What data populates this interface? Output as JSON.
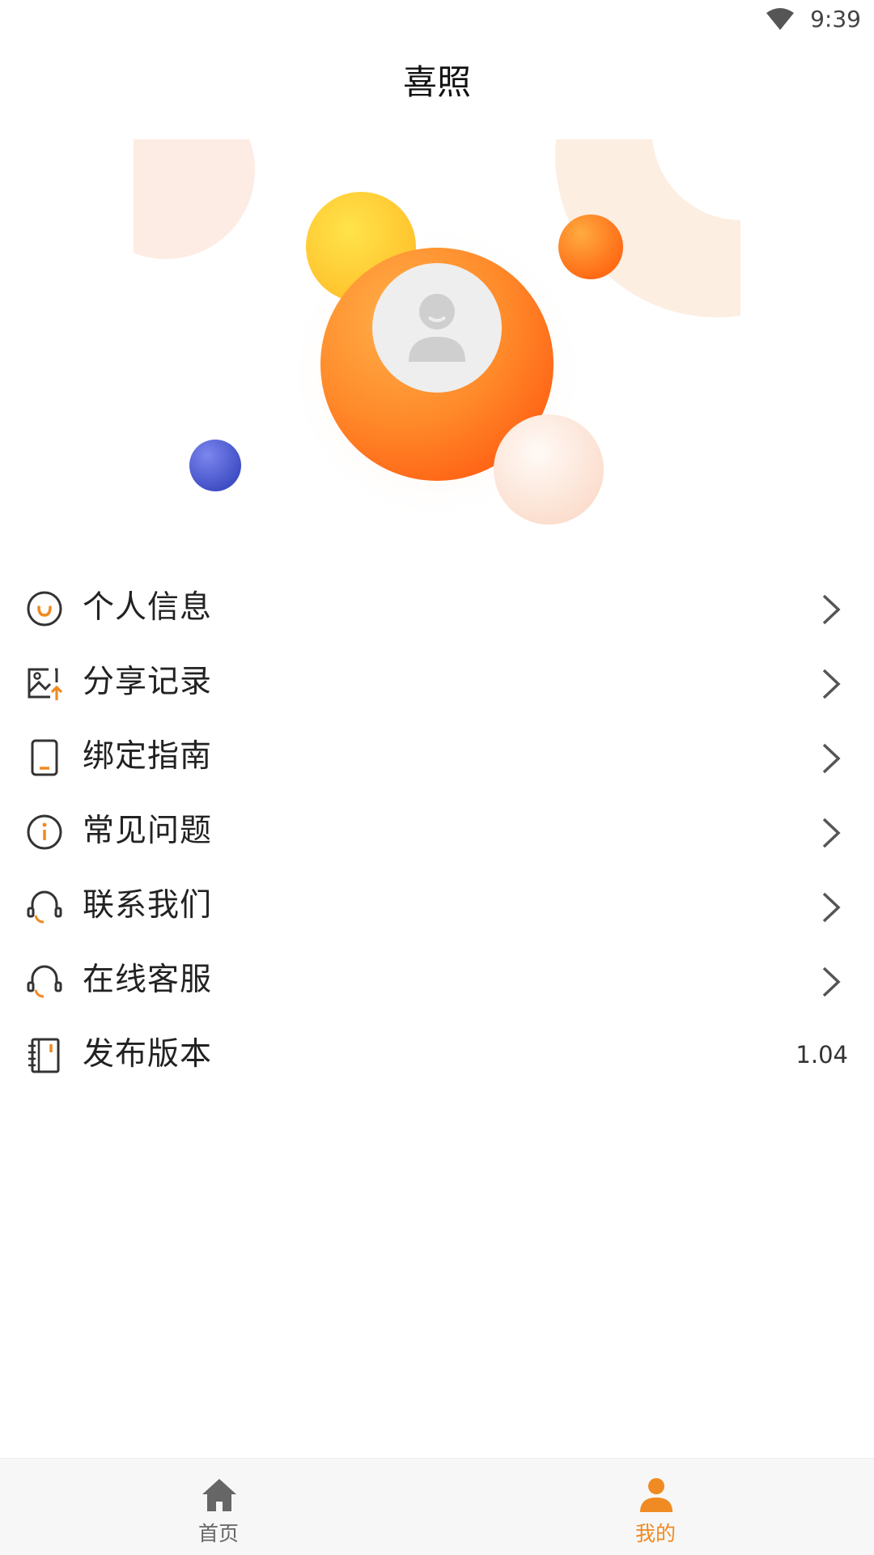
{
  "status_bar": {
    "time": "9:39",
    "wifi_icon": "wifi-icon"
  },
  "header": {
    "title": "喜照"
  },
  "profile": {
    "avatar_icon": "default-avatar-icon"
  },
  "menu": {
    "items": [
      {
        "label": "个人信息",
        "icon": "smile-icon",
        "trailing": "chevron-right-icon"
      },
      {
        "label": "分享记录",
        "icon": "image-upload-icon",
        "trailing": "chevron-right-icon"
      },
      {
        "label": "绑定指南",
        "icon": "tablet-icon",
        "trailing": "chevron-right-icon"
      },
      {
        "label": "常见问题",
        "icon": "info-icon",
        "trailing": "chevron-right-icon"
      },
      {
        "label": "联系我们",
        "icon": "headset-icon",
        "trailing": "chevron-right-icon"
      },
      {
        "label": "在线客服",
        "icon": "headset-icon",
        "trailing": "chevron-right-icon"
      },
      {
        "label": "发布版本",
        "icon": "notebook-icon",
        "value": "1.04"
      }
    ]
  },
  "tab_bar": {
    "tabs": [
      {
        "label": "首页",
        "icon": "home-icon",
        "active": false
      },
      {
        "label": "我的",
        "icon": "person-icon",
        "active": true
      }
    ]
  },
  "colors": {
    "accent": "#f08a22",
    "icon_dark": "#333333",
    "inactive_tab": "#666666",
    "tab_bar_bg": "#f7f7f7"
  }
}
